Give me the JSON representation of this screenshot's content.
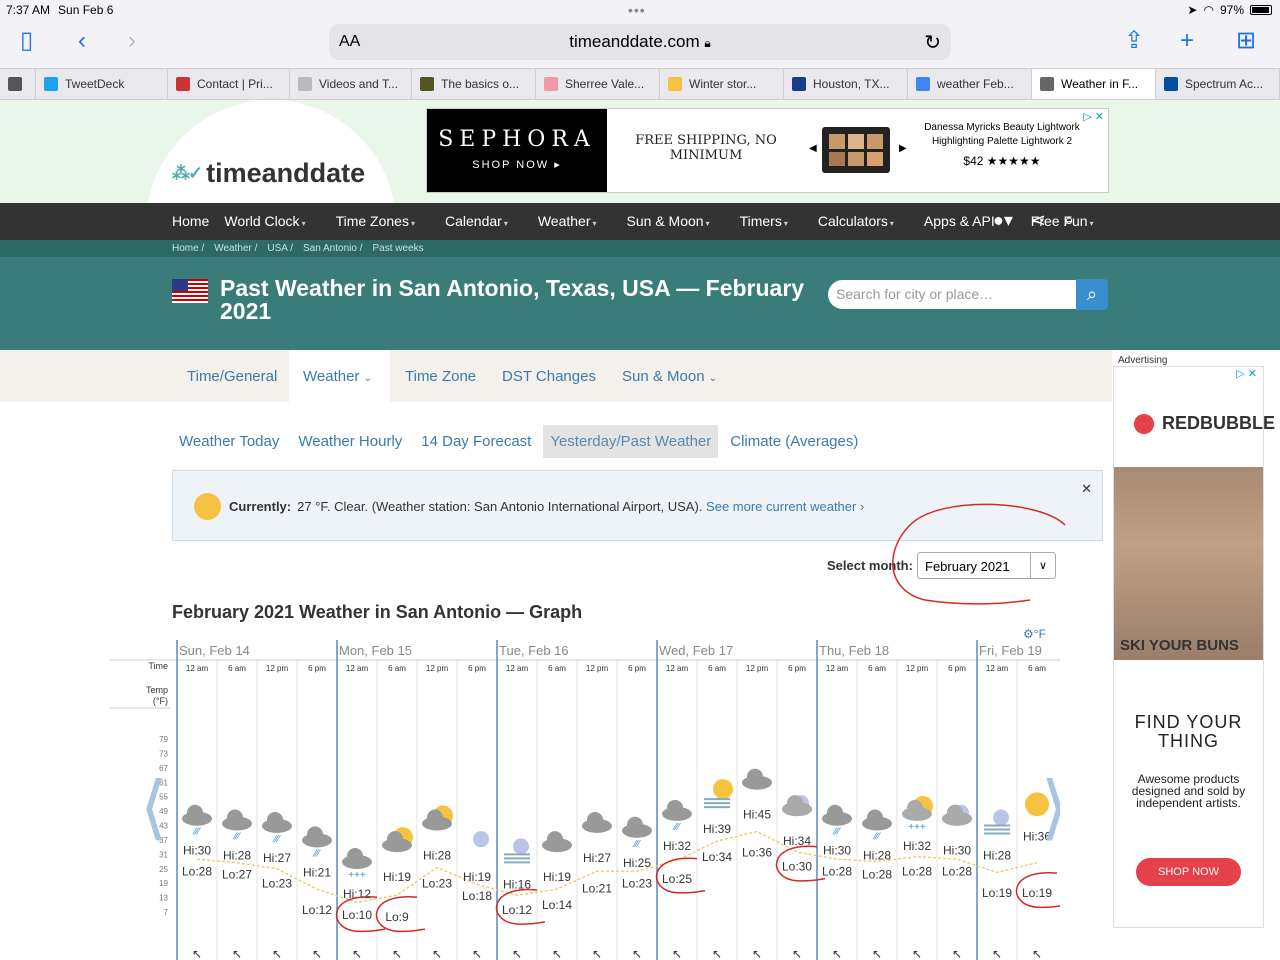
{
  "status": {
    "time": "7:37 AM",
    "date": "Sun Feb 6",
    "battery": "97%"
  },
  "browser": {
    "text_size": "AA",
    "url": "timeanddate.com",
    "tabs": [
      {
        "label": "",
        "color": "#555"
      },
      {
        "label": "TweetDeck",
        "color": "#1da1f2"
      },
      {
        "label": "Contact | Pri...",
        "color": "#c33"
      },
      {
        "label": "Videos and T...",
        "color": "#bbb"
      },
      {
        "label": "The basics o...",
        "color": "#552"
      },
      {
        "label": "Sherree Vale...",
        "color": "#e9a"
      },
      {
        "label": "Winter stor...",
        "color": "#f5c242"
      },
      {
        "label": "Houston, TX...",
        "color": "#1a3a8a"
      },
      {
        "label": "weather Feb...",
        "color": "#4285f4"
      },
      {
        "label": "Weather in F...",
        "color": "#666"
      },
      {
        "label": "Spectrum Ac...",
        "color": "#0050a0"
      }
    ]
  },
  "site": {
    "logo": "timeanddate"
  },
  "ad_top": {
    "brand": "SEPHORA",
    "shop": "SHOP NOW ▸",
    "shipping": "FREE SHIPPING, NO MINIMUM",
    "product": "Danessa Myricks Beauty Lightwork Highlighting Palette Lightwork 2",
    "price": "$42",
    "stars": "★★★★★"
  },
  "nav": [
    "Home",
    "World Clock",
    "Time Zones",
    "Calendar",
    "Weather",
    "Sun & Moon",
    "Timers",
    "Calculators",
    "Apps & API",
    "Free Fun"
  ],
  "breadcrumb": [
    "Home",
    "Weather",
    "USA",
    "San Antonio",
    "Past weeks"
  ],
  "page_title": "Past Weather in San Antonio, Texas, USA — February 2021",
  "search": {
    "placeholder": "Search for city or place…"
  },
  "subnav": [
    "Time/General",
    "Weather",
    "Time Zone",
    "DST Changes",
    "Sun & Moon"
  ],
  "pills": [
    "Weather Today",
    "Weather Hourly",
    "14 Day Forecast",
    "Yesterday/Past Weather",
    "Climate (Averages)"
  ],
  "current": {
    "label": "Currently:",
    "text": "27 °F. Clear. (Weather station: San Antonio International Airport, USA).",
    "link": "See more current weather"
  },
  "select_month": {
    "label": "Select month:",
    "value": "February 2021"
  },
  "graph": {
    "title": "February 2021 Weather in San Antonio — Graph",
    "unit": "°F",
    "row_time": "Time",
    "row_temp": "Temp (°F)",
    "days": [
      "Sun, Feb 14",
      "Mon, Feb 15",
      "Tue, Feb 16",
      "Wed, Feb 17",
      "Thu, Feb 18",
      "Fri, Feb 19"
    ],
    "times": [
      "12 am",
      "6 am",
      "12 pm",
      "6 pm"
    ],
    "y_ticks": [
      79,
      73,
      67,
      61,
      55,
      49,
      43,
      37,
      31,
      25,
      19,
      13,
      7
    ],
    "slots": [
      {
        "hi": 30,
        "lo": 28,
        "icon": "snow"
      },
      {
        "hi": 28,
        "lo": 27,
        "icon": "snow"
      },
      {
        "hi": 27,
        "lo": 23,
        "icon": "snow"
      },
      {
        "hi": 21,
        "lo": 12,
        "icon": "snow"
      },
      {
        "hi": 12,
        "lo": 10,
        "icon": "snow-partly"
      },
      {
        "hi": 19,
        "lo": 9,
        "icon": "sun-cloud"
      },
      {
        "hi": 28,
        "lo": 23,
        "icon": "sun-cloud"
      },
      {
        "hi": 19,
        "lo": 18,
        "icon": "moon"
      },
      {
        "hi": 16,
        "lo": 12,
        "icon": "moon-fog"
      },
      {
        "hi": 19,
        "lo": 14,
        "icon": "cloud"
      },
      {
        "hi": 27,
        "lo": 21,
        "icon": "cloud"
      },
      {
        "hi": 25,
        "lo": 23,
        "icon": "rain"
      },
      {
        "hi": 32,
        "lo": 25,
        "icon": "rain"
      },
      {
        "hi": 39,
        "lo": 34,
        "icon": "sun-fog"
      },
      {
        "hi": 45,
        "lo": 36,
        "icon": "cloud"
      },
      {
        "hi": 34,
        "lo": 30,
        "icon": "moon-cloud"
      },
      {
        "hi": 30,
        "lo": 28,
        "icon": "rain"
      },
      {
        "hi": 28,
        "lo": 28,
        "icon": "snow"
      },
      {
        "hi": 32,
        "lo": 28,
        "icon": "sun-snow"
      },
      {
        "hi": 30,
        "lo": 28,
        "icon": "moon-cloud"
      },
      {
        "hi": 28,
        "lo": 19,
        "icon": "moon-fog"
      },
      {
        "hi": 36,
        "lo": 19,
        "icon": "sun"
      }
    ]
  },
  "right_ad": {
    "advertising": "Advertising",
    "brand": "REDBUBBLE",
    "caption": "SKI YOUR BUNS",
    "headline": "FIND YOUR THING",
    "body": "Awesome products designed and sold by independent artists.",
    "cta": "SHOP NOW"
  },
  "colors": {
    "teal": "#3a7c7a",
    "nav": "#333333",
    "link": "#3a7ab0",
    "annotation": "#d42a2a"
  }
}
